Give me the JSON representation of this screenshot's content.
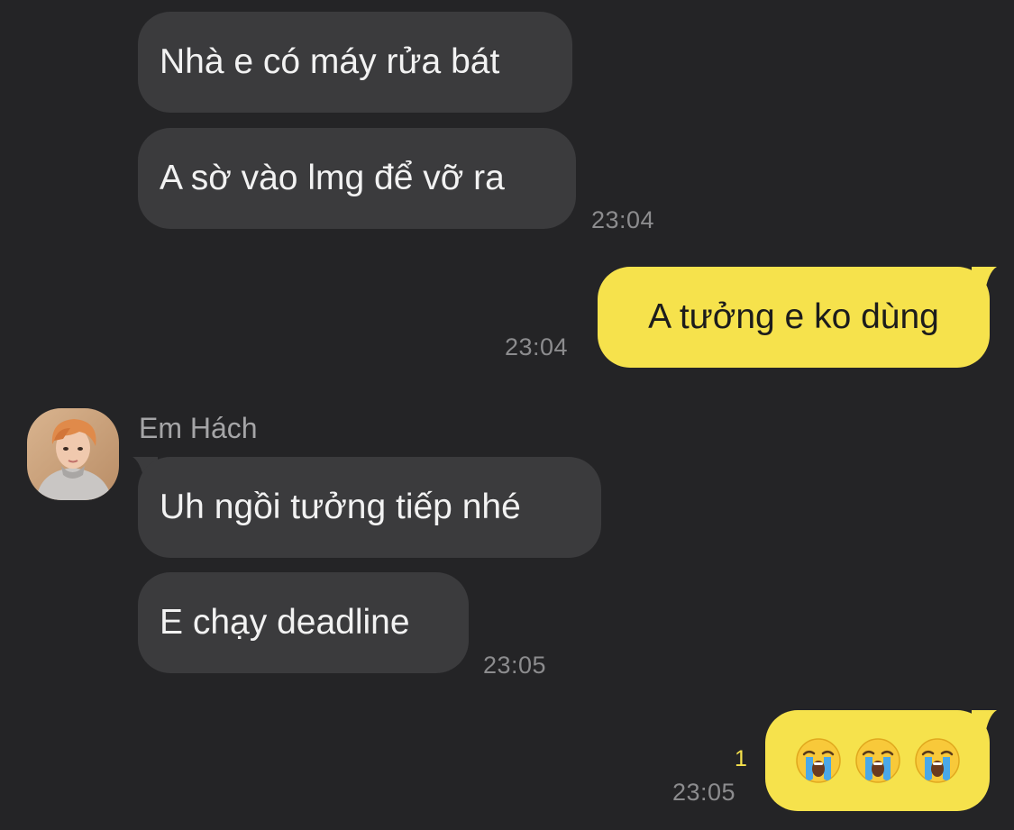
{
  "messages": [
    {
      "text": "Nhà e có máy rửa bát"
    },
    {
      "text": "A sờ vào lmg để vỡ ra"
    },
    {
      "text": "A tưởng e ko dùng"
    },
    {
      "text": "Uh ngồi tưởng tiếp nhé"
    },
    {
      "text": "E chạy deadline"
    },
    {
      "emojis": [
        "loudly-crying-face",
        "loudly-crying-face",
        "loudly-crying-face"
      ]
    }
  ],
  "timestamps": {
    "t1": "23:04",
    "t2": "23:04",
    "t3": "23:05",
    "t4": "23:05"
  },
  "sender": {
    "name": "Em Hách"
  },
  "unread_count": "1",
  "colors": {
    "background": "#242426",
    "incoming_bubble": "#3b3b3d",
    "outgoing_bubble": "#f6e24c",
    "timestamp": "#8c8c8e",
    "unread": "#f6e24c"
  }
}
